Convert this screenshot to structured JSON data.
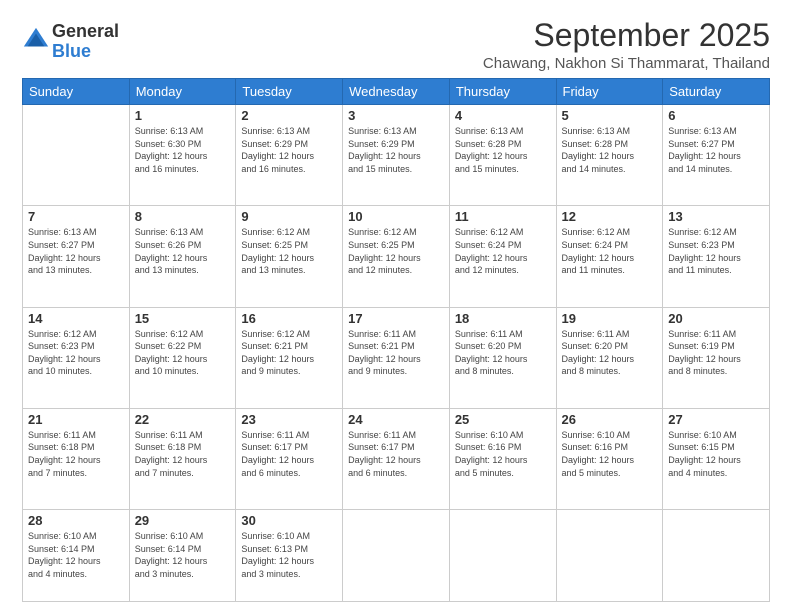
{
  "logo": {
    "general": "General",
    "blue": "Blue"
  },
  "title": "September 2025",
  "subtitle": "Chawang, Nakhon Si Thammarat, Thailand",
  "days": [
    "Sunday",
    "Monday",
    "Tuesday",
    "Wednesday",
    "Thursday",
    "Friday",
    "Saturday"
  ],
  "weeks": [
    [
      {
        "day": "",
        "info": ""
      },
      {
        "day": "1",
        "info": "Sunrise: 6:13 AM\nSunset: 6:30 PM\nDaylight: 12 hours\nand 16 minutes."
      },
      {
        "day": "2",
        "info": "Sunrise: 6:13 AM\nSunset: 6:29 PM\nDaylight: 12 hours\nand 16 minutes."
      },
      {
        "day": "3",
        "info": "Sunrise: 6:13 AM\nSunset: 6:29 PM\nDaylight: 12 hours\nand 15 minutes."
      },
      {
        "day": "4",
        "info": "Sunrise: 6:13 AM\nSunset: 6:28 PM\nDaylight: 12 hours\nand 15 minutes."
      },
      {
        "day": "5",
        "info": "Sunrise: 6:13 AM\nSunset: 6:28 PM\nDaylight: 12 hours\nand 14 minutes."
      },
      {
        "day": "6",
        "info": "Sunrise: 6:13 AM\nSunset: 6:27 PM\nDaylight: 12 hours\nand 14 minutes."
      }
    ],
    [
      {
        "day": "7",
        "info": "Sunrise: 6:13 AM\nSunset: 6:27 PM\nDaylight: 12 hours\nand 13 minutes."
      },
      {
        "day": "8",
        "info": "Sunrise: 6:13 AM\nSunset: 6:26 PM\nDaylight: 12 hours\nand 13 minutes."
      },
      {
        "day": "9",
        "info": "Sunrise: 6:12 AM\nSunset: 6:25 PM\nDaylight: 12 hours\nand 13 minutes."
      },
      {
        "day": "10",
        "info": "Sunrise: 6:12 AM\nSunset: 6:25 PM\nDaylight: 12 hours\nand 12 minutes."
      },
      {
        "day": "11",
        "info": "Sunrise: 6:12 AM\nSunset: 6:24 PM\nDaylight: 12 hours\nand 12 minutes."
      },
      {
        "day": "12",
        "info": "Sunrise: 6:12 AM\nSunset: 6:24 PM\nDaylight: 12 hours\nand 11 minutes."
      },
      {
        "day": "13",
        "info": "Sunrise: 6:12 AM\nSunset: 6:23 PM\nDaylight: 12 hours\nand 11 minutes."
      }
    ],
    [
      {
        "day": "14",
        "info": "Sunrise: 6:12 AM\nSunset: 6:23 PM\nDaylight: 12 hours\nand 10 minutes."
      },
      {
        "day": "15",
        "info": "Sunrise: 6:12 AM\nSunset: 6:22 PM\nDaylight: 12 hours\nand 10 minutes."
      },
      {
        "day": "16",
        "info": "Sunrise: 6:12 AM\nSunset: 6:21 PM\nDaylight: 12 hours\nand 9 minutes."
      },
      {
        "day": "17",
        "info": "Sunrise: 6:11 AM\nSunset: 6:21 PM\nDaylight: 12 hours\nand 9 minutes."
      },
      {
        "day": "18",
        "info": "Sunrise: 6:11 AM\nSunset: 6:20 PM\nDaylight: 12 hours\nand 8 minutes."
      },
      {
        "day": "19",
        "info": "Sunrise: 6:11 AM\nSunset: 6:20 PM\nDaylight: 12 hours\nand 8 minutes."
      },
      {
        "day": "20",
        "info": "Sunrise: 6:11 AM\nSunset: 6:19 PM\nDaylight: 12 hours\nand 8 minutes."
      }
    ],
    [
      {
        "day": "21",
        "info": "Sunrise: 6:11 AM\nSunset: 6:18 PM\nDaylight: 12 hours\nand 7 minutes."
      },
      {
        "day": "22",
        "info": "Sunrise: 6:11 AM\nSunset: 6:18 PM\nDaylight: 12 hours\nand 7 minutes."
      },
      {
        "day": "23",
        "info": "Sunrise: 6:11 AM\nSunset: 6:17 PM\nDaylight: 12 hours\nand 6 minutes."
      },
      {
        "day": "24",
        "info": "Sunrise: 6:11 AM\nSunset: 6:17 PM\nDaylight: 12 hours\nand 6 minutes."
      },
      {
        "day": "25",
        "info": "Sunrise: 6:10 AM\nSunset: 6:16 PM\nDaylight: 12 hours\nand 5 minutes."
      },
      {
        "day": "26",
        "info": "Sunrise: 6:10 AM\nSunset: 6:16 PM\nDaylight: 12 hours\nand 5 minutes."
      },
      {
        "day": "27",
        "info": "Sunrise: 6:10 AM\nSunset: 6:15 PM\nDaylight: 12 hours\nand 4 minutes."
      }
    ],
    [
      {
        "day": "28",
        "info": "Sunrise: 6:10 AM\nSunset: 6:14 PM\nDaylight: 12 hours\nand 4 minutes."
      },
      {
        "day": "29",
        "info": "Sunrise: 6:10 AM\nSunset: 6:14 PM\nDaylight: 12 hours\nand 3 minutes."
      },
      {
        "day": "30",
        "info": "Sunrise: 6:10 AM\nSunset: 6:13 PM\nDaylight: 12 hours\nand 3 minutes."
      },
      {
        "day": "",
        "info": ""
      },
      {
        "day": "",
        "info": ""
      },
      {
        "day": "",
        "info": ""
      },
      {
        "day": "",
        "info": ""
      }
    ]
  ]
}
